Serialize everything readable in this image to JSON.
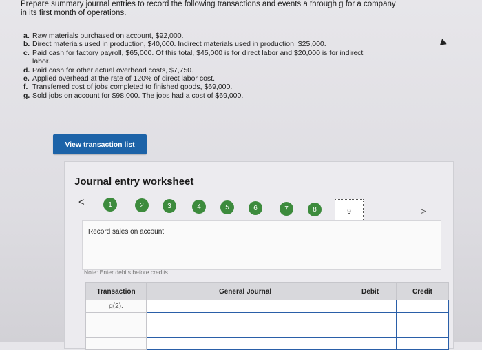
{
  "instructions": {
    "line1": "Prepare summary journal entries to record the following transactions and events a through g for a company",
    "line2": "in its first month of operations."
  },
  "transactions": [
    {
      "letter": "a.",
      "text": "Raw materials purchased on account, $92,000."
    },
    {
      "letter": "b.",
      "text": "Direct materials used in production, $40,000. Indirect materials used in production, $25,000."
    },
    {
      "letter": "c.",
      "text": "Paid cash for factory payroll, $65,000. Of this total, $45,000 is for direct labor and $20,000 is for indirect",
      "cont": "labor."
    },
    {
      "letter": "d.",
      "text": "Paid cash for other actual overhead costs, $7,750."
    },
    {
      "letter": "e.",
      "text": "Applied overhead at the rate of 120% of direct labor cost."
    },
    {
      "letter": "f.",
      "text": "Transferred cost of jobs completed to finished goods, $69,000."
    },
    {
      "letter": "g.",
      "text": "Sold jobs on account for $98,000. The jobs had a cost of $69,000."
    }
  ],
  "view_button": "View transaction list",
  "worksheet": {
    "title": "Journal entry worksheet",
    "prev": "<",
    "next": ">",
    "steps": [
      "1",
      "2",
      "3",
      "4",
      "5",
      "6",
      "7",
      "8",
      "9"
    ],
    "current_step": "9",
    "record_text": "Record sales on account.",
    "note": "Note: Enter debits before credits.",
    "table": {
      "headers": [
        "Transaction",
        "General Journal",
        "Debit",
        "Credit"
      ],
      "first_row_transaction": "g(2)."
    }
  },
  "colors": {
    "accent": "#1c63a8",
    "step_done": "#3d8b3d"
  }
}
